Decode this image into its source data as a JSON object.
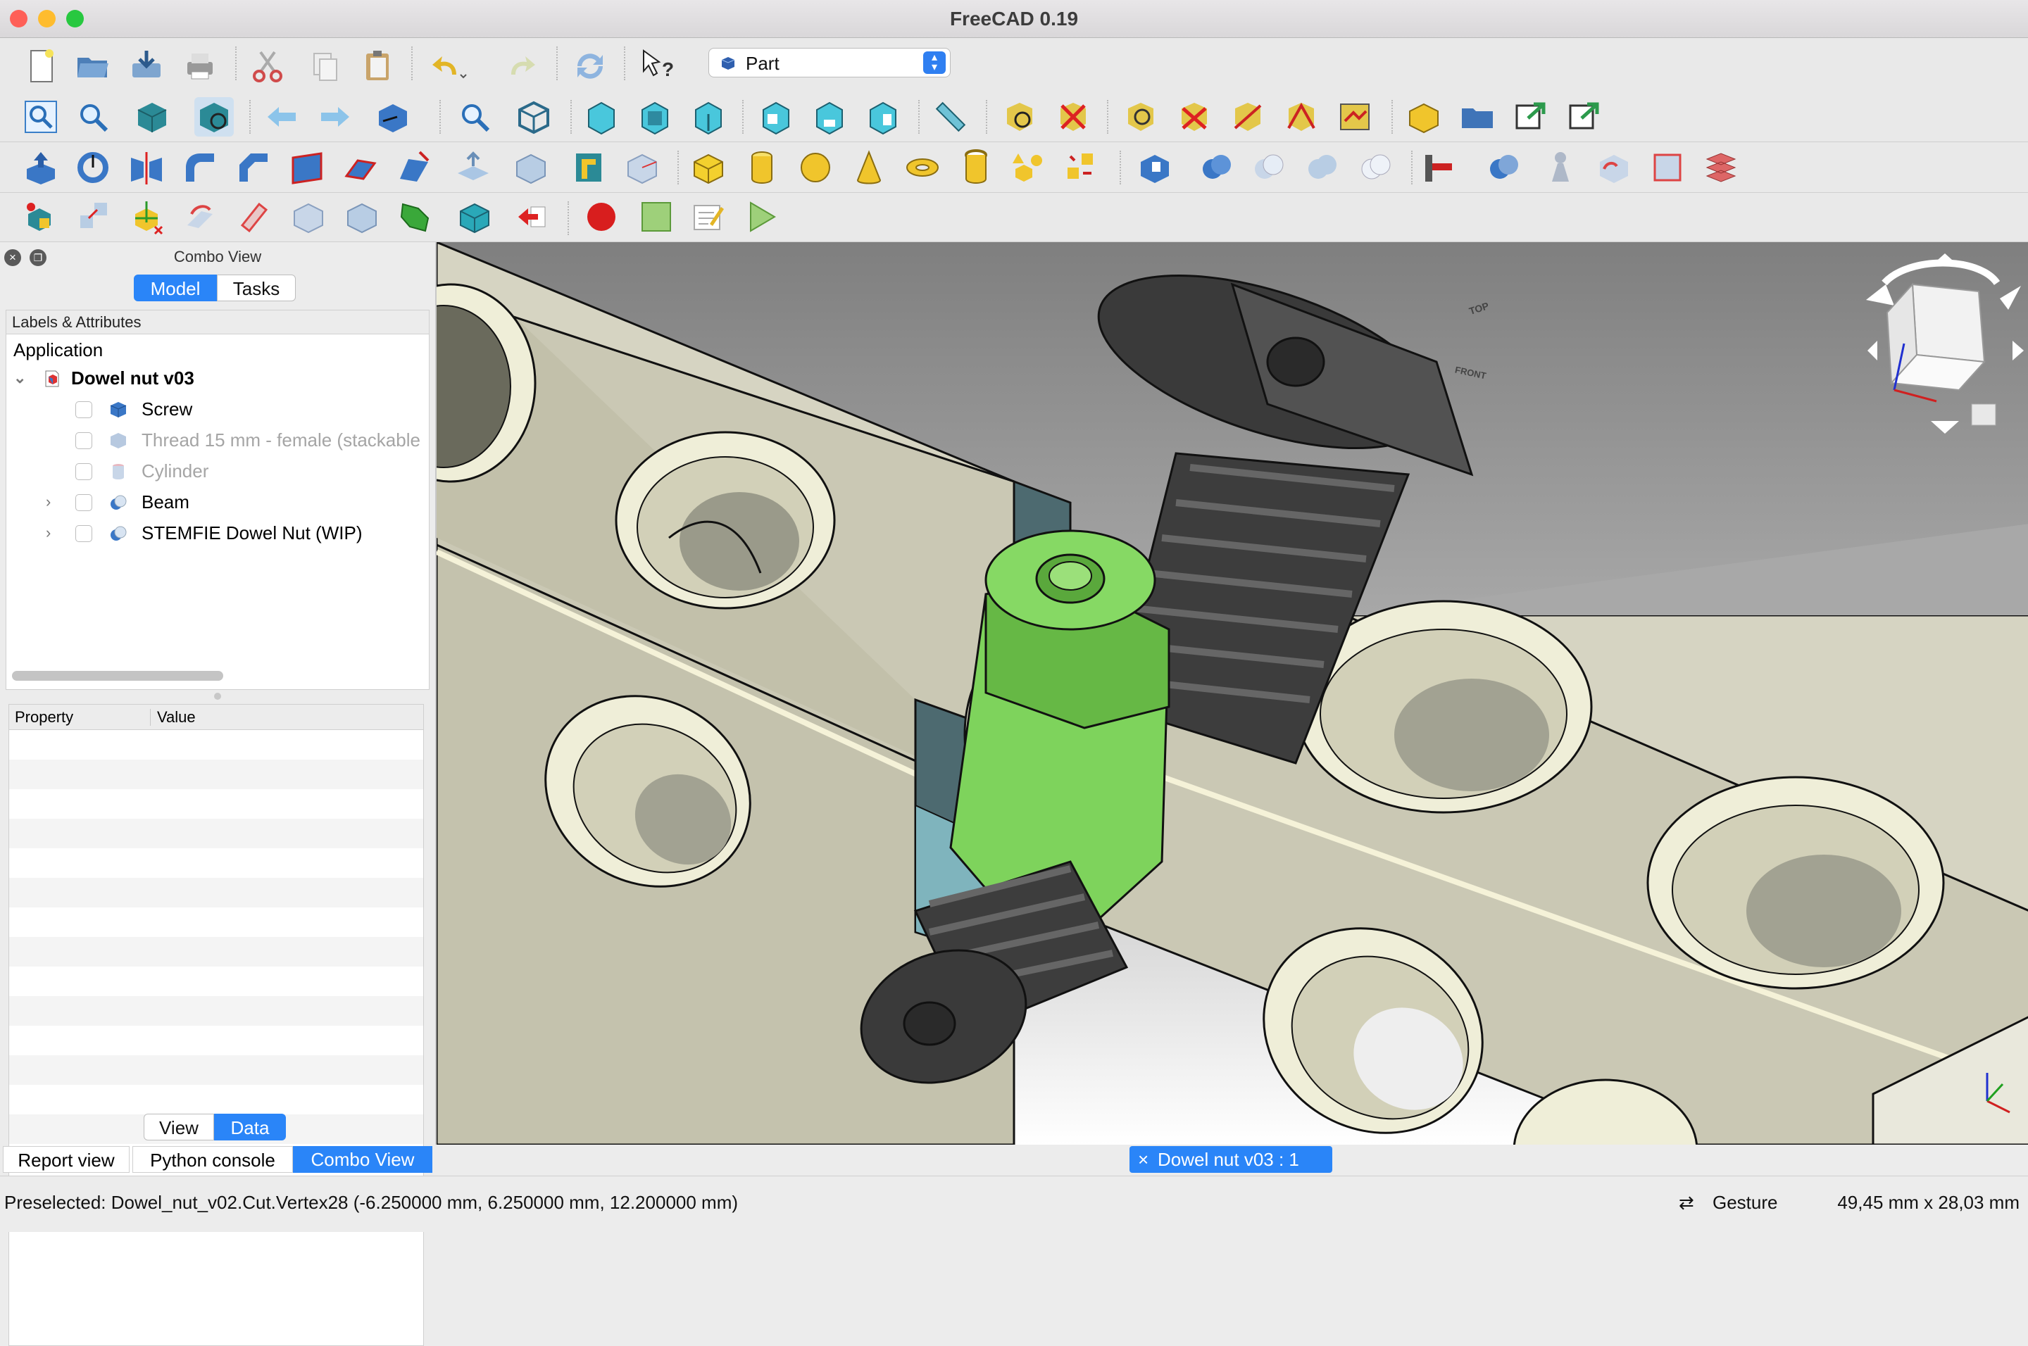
{
  "window": {
    "title": "FreeCAD 0.19"
  },
  "workbench": {
    "selected": "Part"
  },
  "combo": {
    "title": "Combo View",
    "tabs": [
      "Model",
      "Tasks"
    ],
    "tree_header": "Labels & Attributes",
    "root": "Application",
    "document": "Dowel nut v03",
    "items": [
      {
        "label": "Screw",
        "visible": true
      },
      {
        "label": "Thread 15 mm - female (stackable",
        "visible": false
      },
      {
        "label": "Cylinder",
        "visible": false
      },
      {
        "label": "Beam",
        "visible": true
      },
      {
        "label": "STEMFIE Dowel Nut (WIP)",
        "visible": true
      }
    ],
    "property_columns": [
      "Property",
      "Value"
    ],
    "view_tabs": [
      "View",
      "Data"
    ]
  },
  "bottom_tabs": [
    "Report view",
    "Python console",
    "Combo View"
  ],
  "document_tab": "Dowel nut v03 : 1",
  "navcube": {
    "top": "TOP",
    "front": "FRONT"
  },
  "status": {
    "message": "Preselected: Dowel_nut_v02.Cut.Vertex28 (-6.250000 mm, 6.250000 mm, 12.200000 mm)",
    "navigation": "Gesture",
    "dimensions": "49,45 mm x 28,03 mm"
  },
  "colors": {
    "accent": "#2a85f8",
    "beam": "#c9c7b4",
    "nut": "#7ed35c",
    "screw": "#4a4a4a",
    "section": "#4d6a70"
  }
}
